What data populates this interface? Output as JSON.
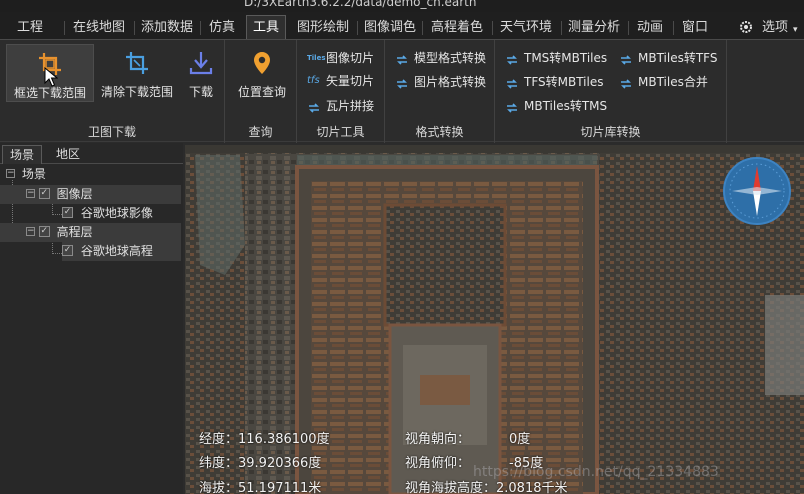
{
  "window": {
    "title": "D:/3XEarth3.6.2.2/data/demo_cn.earth"
  },
  "menu": {
    "items": [
      "工程",
      "在线地图",
      "添加数据",
      "仿真",
      "工具",
      "图形绘制",
      "图像调色",
      "高程着色",
      "天气环境",
      "测量分析",
      "动画",
      "窗口"
    ],
    "active": "工具",
    "options_label": "选项"
  },
  "ribbon": {
    "groups": {
      "download": {
        "label": "卫图下载",
        "buttons": [
          "框选下载范围",
          "清除下载范围",
          "下载"
        ]
      },
      "query": {
        "label": "查询",
        "buttons": [
          "位置查询"
        ]
      },
      "tile_tools": {
        "label": "切片工具",
        "buttons": [
          "图像切片",
          "矢量切片",
          "瓦片拼接"
        ],
        "icon_texts": [
          "Tiles",
          "tfs"
        ]
      },
      "format": {
        "label": "格式转换",
        "buttons": [
          "模型格式转换",
          "图片格式转换"
        ]
      },
      "tilelib": {
        "label": "切片库转换",
        "buttons": [
          "TMS转MBTiles",
          "MBTiles转TFS",
          "TFS转MBTiles",
          "MBTiles合并",
          "MBTiles转TMS"
        ]
      }
    }
  },
  "panel": {
    "tabs": [
      "场景",
      "地区"
    ],
    "active_tab": "场景",
    "tree": {
      "root": "场景",
      "image_layer": "图像层",
      "image_item": "谷歌地球影像",
      "elevation_layer": "高程层",
      "elevation_item": "谷歌地球高程"
    }
  },
  "status": {
    "longitude": "经度：116.386100度",
    "latitude": "纬度：39.920366度",
    "altitude": "海拔：51.197111米",
    "heading_label": "视角朝向：",
    "heading_value": "0度",
    "pitch_label": "视角俯仰：",
    "pitch_value": "-85度",
    "view_alt": "视角海拔高度：2.0818千米"
  },
  "watermark": "https://blog.csdn.net/qq_21334883",
  "colors": {
    "accent_orange": "#e8922e",
    "accent_blue": "#4a9fe0",
    "compass_blue": "#2e6fa8"
  },
  "icons": [
    "crop-select-icon",
    "crop-clear-icon",
    "download-icon",
    "location-pin-icon",
    "convert-icon",
    "compass-icon"
  ]
}
